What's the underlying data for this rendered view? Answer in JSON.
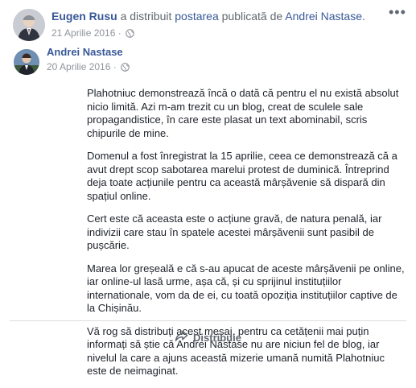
{
  "share_header": {
    "sharer_name": "Eugen Rusu",
    "middle_text": "a distribuit",
    "post_link": "postarea",
    "published_by_text": "publicată de",
    "author_name": "Andrei Nastase",
    "period": ".",
    "date": "21 Aprilie 2016",
    "date_separator": "·",
    "privacy_icon": "globe-icon",
    "more_options_icon": "more-options-icon"
  },
  "original_post": {
    "author_name": "Andrei Nastase",
    "date": "20 Aprilie 2016",
    "date_separator": "·",
    "privacy_icon": "globe-icon",
    "paragraphs": [
      "Plahotniuc demonstrează încă o dată că pentru el nu există absolut nicio limită. Azi m-am trezit cu un blog, creat de sculele sale propagandistice, în care este plasat un text abominabil, scris chipurile de mine.",
      "Domenul a fost înregistrat la 15 aprilie, ceea ce demonstrează că a avut drept scop sabotarea marelui protest de duminică. Întreprind deja toate acțiunile pentru ca această mârșăvenie să dispară din spațiul online.",
      "Cert este că aceasta este o acțiune gravă, de natura penală, iar indivizii care stau în spatele acestei mârșăvenii sunt pasibil de pușcărie.",
      "Marea lor greșeală e că s-au apucat de aceste mârșăvenii pe online, iar online-ul lasă urme, așa că, și cu sprijinul instituțiilor internationale, vom da de ei, cu toată opoziția instituțiilor captive de la Chișinău.",
      "Vă rog să distribuți acest mesaj, pentru ca cetățenii mai puțin informați să știe că Andrei Năstase nu are niciun fel de blog, iar nivelul la care a ajuns această mizerie umană numită Plahotniuc este de neimaginat."
    ]
  },
  "footer": {
    "share_label": "Distribuie",
    "share_icon": "share-arrow-icon"
  },
  "colors": {
    "link": "#385898",
    "text": "#1d2129",
    "muted": "#90949c",
    "divider": "#dadde1"
  }
}
